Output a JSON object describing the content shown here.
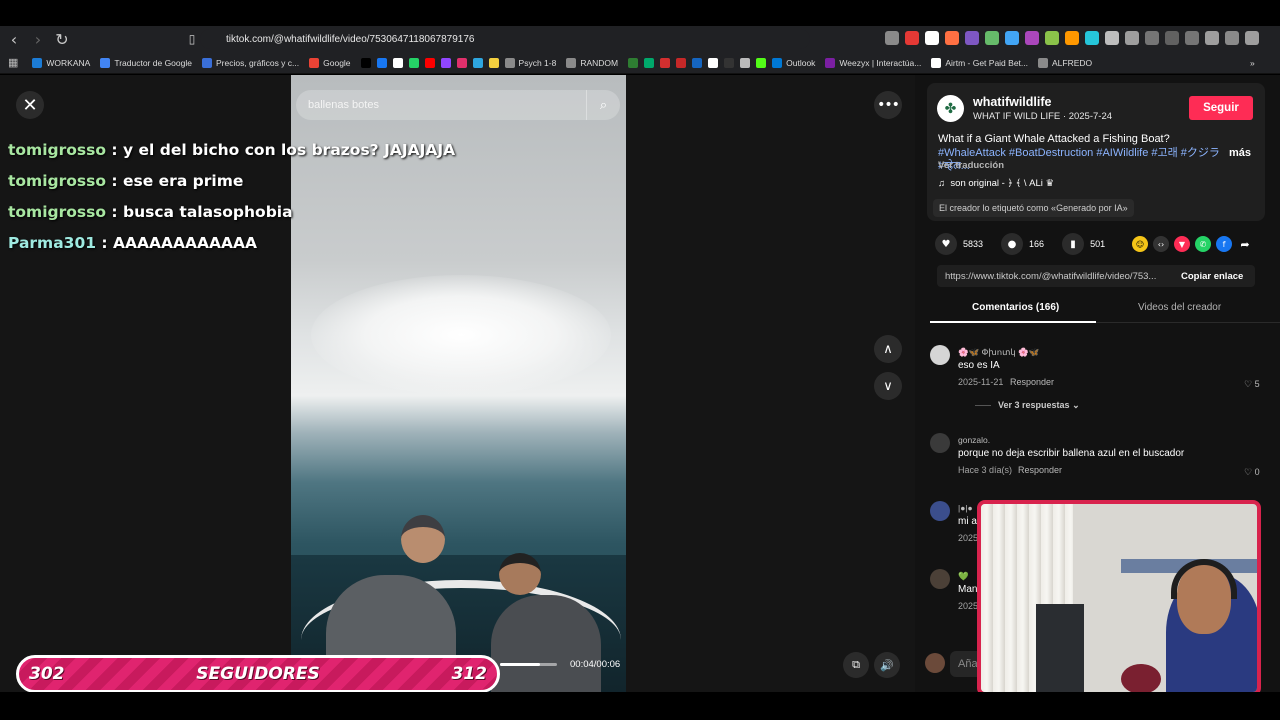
{
  "browser": {
    "url": "tiktok.com/@whatifwildlife/video/7530647118067879176",
    "bookmarks": [
      {
        "label": "WORKANA",
        "color": "#1c7cd6"
      },
      {
        "label": "Traductor de Google",
        "color": "#4285f4"
      },
      {
        "label": "Precios, gráficos y c...",
        "color": "#3a6fd8"
      },
      {
        "label": "Google",
        "color": "#ea4335"
      },
      {
        "label": "",
        "color": "#000000"
      },
      {
        "label": "",
        "color": "#1877f2"
      },
      {
        "label": "",
        "color": "#ffffff"
      },
      {
        "label": "",
        "color": "#25d366"
      },
      {
        "label": "",
        "color": "#ff0000"
      },
      {
        "label": "",
        "color": "#9146ff"
      },
      {
        "label": "",
        "color": "#e1306c"
      },
      {
        "label": "",
        "color": "#2ea6df"
      },
      {
        "label": "",
        "color": "#f4d03f"
      },
      {
        "label": "Psych 1-8",
        "color": "#8a8a8a"
      },
      {
        "label": "RANDOM",
        "color": "#8a8a8a"
      },
      {
        "label": "",
        "color": "#2e7d32"
      },
      {
        "label": "",
        "color": "#00a86b"
      },
      {
        "label": "",
        "color": "#d32f2f"
      },
      {
        "label": "",
        "color": "#c62828"
      },
      {
        "label": "",
        "color": "#1565c0"
      },
      {
        "label": "",
        "color": "#ffffff"
      },
      {
        "label": "",
        "color": "#333333"
      },
      {
        "label": "",
        "color": "#bbbbbb"
      },
      {
        "label": "",
        "color": "#53fc18"
      },
      {
        "label": "Outlook",
        "color": "#0078d4"
      },
      {
        "label": "Weezyx | Interactúa...",
        "color": "#7b1fa2"
      },
      {
        "label": "Airtm - Get Paid Bet...",
        "color": "#ffffff"
      },
      {
        "label": "ALFREDO",
        "color": "#8a8a8a"
      }
    ]
  },
  "video": {
    "search_query": "ballenas botes",
    "time": "00:04/00:06",
    "progress_fraction": 0.7
  },
  "chat": [
    {
      "user": "tomigrosso",
      "message": ": y el del bicho con los brazos? JAJAJAJA"
    },
    {
      "user": "tomigrosso",
      "message": ": ese era prime"
    },
    {
      "user": "tomigrosso",
      "message": ": busca talasophobia"
    },
    {
      "user": "Parma301",
      "message": ": AAAAAAAAAAAA"
    }
  ],
  "followers": {
    "current": "302",
    "label": "SEGUIDORES",
    "goal": "312"
  },
  "post": {
    "username": "whatifwildlife",
    "display_line": "WHAT IF WILD LIFE · 2025-7-24",
    "follow_label": "Seguir",
    "description": "What if a Giant Whale Attacked a Fishing Boat?",
    "tags": "#WhaleAttack #BoatDestruction #AIWildlife #고래 #クジラ #व्हेल...",
    "more_label": "más",
    "translate_label": "Ver traducción",
    "music": "son original - ﴿ ﴾ \\ ALi ♛",
    "ai_label": "El creador lo etiquetó como «Generado por IA»",
    "likes": "5833",
    "comments": "166",
    "saves": "501",
    "link": "https://www.tiktok.com/@whatifwildlife/video/753...",
    "copy_label": "Copiar enlace"
  },
  "tabs": {
    "comments": "Comentarios (166)",
    "creator_videos": "Videos del creador"
  },
  "comments_list": [
    {
      "user": "🌸🦋 Փխոտկ 🌸🦋",
      "text": "eso es IA",
      "date": "2025-11-21",
      "reply": "Responder",
      "likes": "5",
      "more": "Ver 3 respuestas"
    },
    {
      "user": "gonzalo.",
      "text": "porque no deja escribir ballena azul en el buscador",
      "date": "Hace 3 día(s)",
      "reply": "Responder",
      "likes": "0"
    },
    {
      "user": "|●|●",
      "text": "mi a",
      "date": "2025"
    },
    {
      "user": "💚",
      "text": "Man",
      "date": "2025"
    }
  ],
  "add_comment_placeholder": "Aña"
}
